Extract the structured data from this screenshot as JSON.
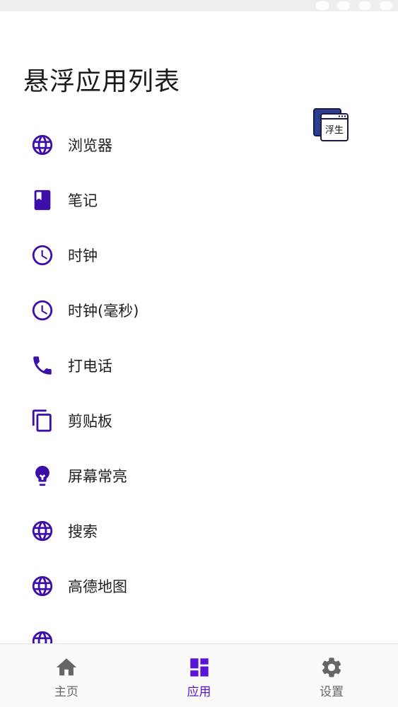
{
  "header": {
    "title": "悬浮应用列表"
  },
  "floating_widget": {
    "label": "浮生",
    "icon": "floating-window-icon"
  },
  "apps": [
    {
      "label": "浏览器",
      "icon": "globe-icon"
    },
    {
      "label": "笔记",
      "icon": "book-icon"
    },
    {
      "label": "时钟",
      "icon": "clock-icon"
    },
    {
      "label": "时钟(毫秒)",
      "icon": "clock-icon"
    },
    {
      "label": "打电话",
      "icon": "phone-icon"
    },
    {
      "label": "剪贴板",
      "icon": "copy-icon"
    },
    {
      "label": "屏幕常亮",
      "icon": "lightbulb-icon"
    },
    {
      "label": "搜索",
      "icon": "globe-icon"
    },
    {
      "label": "高德地图",
      "icon": "globe-icon"
    },
    {
      "label": "",
      "icon": "globe-icon"
    }
  ],
  "bottom_nav": {
    "items": [
      {
        "label": "主页",
        "icon": "home-icon",
        "active": false
      },
      {
        "label": "应用",
        "icon": "dashboard-icon",
        "active": true
      },
      {
        "label": "设置",
        "icon": "gear-icon",
        "active": false
      }
    ]
  },
  "colors": {
    "accent": "#3d0fa8",
    "accent_active": "#5a14d8",
    "nav_inactive": "#666666",
    "background": "#ffffff"
  }
}
